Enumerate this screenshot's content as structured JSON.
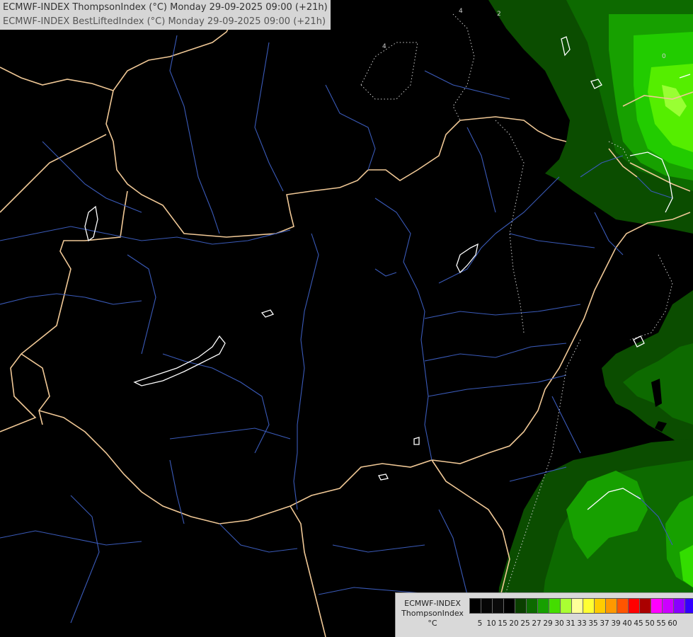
{
  "header": {
    "line1": "ECMWF-INDEX ThompsonIndex (°C) Monday 29-09-2025 09:00 (+21h)",
    "line2": "ECMWF-INDEX BestLiftedIndex (°C) Monday 29-09-2025 09:00 (+21h)"
  },
  "legend": {
    "model": "ECMWF-INDEX",
    "parameter": "ThompsonIndex",
    "unit": "°C",
    "tick_labels": [
      "5",
      "10",
      "15",
      "20",
      "25",
      "27",
      "29",
      "30",
      "31",
      "33",
      "35",
      "37",
      "39",
      "40",
      "45",
      "50",
      "55",
      "60"
    ],
    "swatch_colors": [
      "#000000",
      "#060606",
      "#0a0a0a",
      "#000000",
      "#0b3f00",
      "#0d6a00",
      "#17a000",
      "#44dd00",
      "#aaff33",
      "#ffff99",
      "#ffff33",
      "#ffcc00",
      "#ff9900",
      "#ff5500",
      "#ff0000",
      "#aa0000",
      "#ff00ff",
      "#cc00ff",
      "#8800ff",
      "#3300ff"
    ]
  },
  "colors": {
    "background": "#000000",
    "border_lines": "#f0c896",
    "rivers": "#3a5ab8",
    "lakes": "#ffffff",
    "field_dark": "#0b4d00",
    "field_mid": "#0d7a00",
    "field_bright": "#22cc00",
    "field_lime": "#66ff00"
  }
}
